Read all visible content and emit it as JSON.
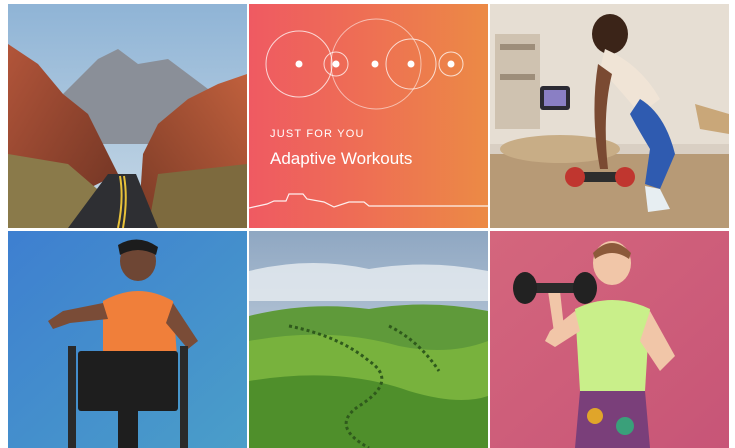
{
  "feature": {
    "eyebrow": "JUST FOR YOU",
    "title": "Adaptive Workouts",
    "colors": {
      "start": "#ef5a62",
      "end": "#ec8a45"
    }
  },
  "tiles": [
    {
      "id": "desert-road",
      "icon": "photo-desert-road"
    },
    {
      "id": "adaptive-workouts",
      "icon": "circles-graphic"
    },
    {
      "id": "woman-dumbbell-row",
      "icon": "photo-woman-dumbbells"
    },
    {
      "id": "man-elliptical",
      "icon": "photo-man-elliptical"
    },
    {
      "id": "tuscany-hills",
      "icon": "photo-green-hills"
    },
    {
      "id": "woman-curl",
      "icon": "photo-woman-curl"
    }
  ]
}
